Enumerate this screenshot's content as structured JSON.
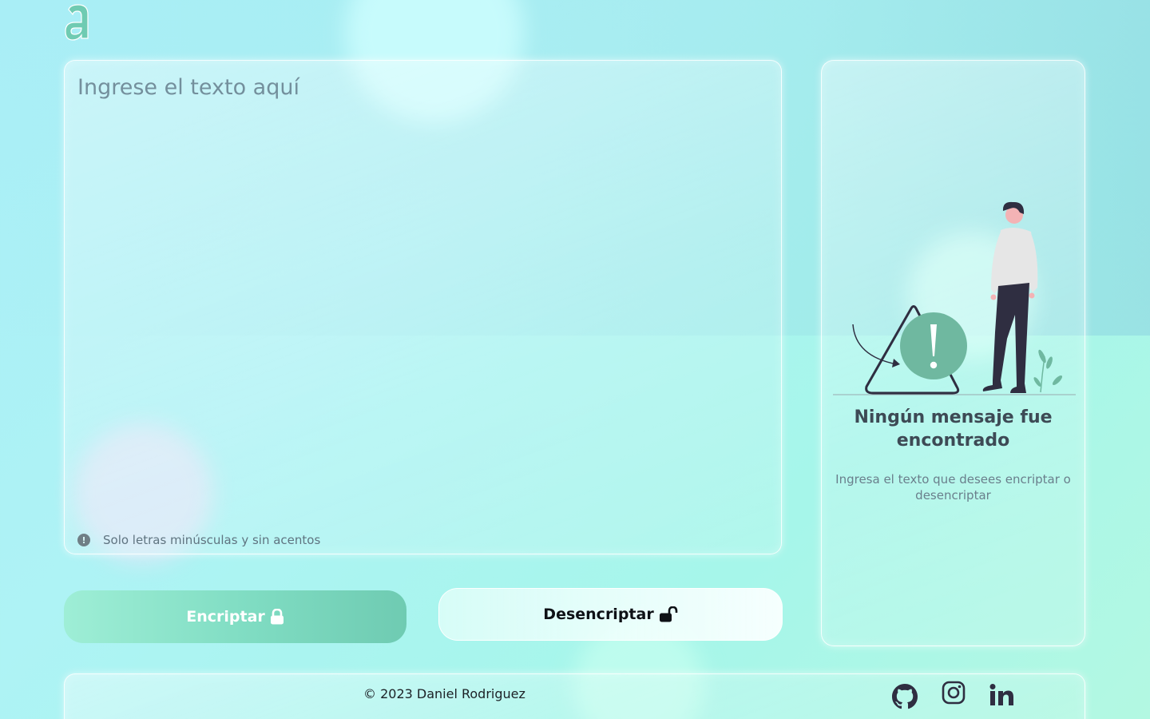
{
  "logo": {
    "glyph": "a",
    "color": "#6fcbb2"
  },
  "editor": {
    "placeholder": "Ingrese el texto aquí",
    "value": "",
    "hint_icon": "exclamation-circle-icon",
    "hint_text": "Solo letras minúsculas y sin acentos"
  },
  "actions": {
    "encrypt_label": "Encriptar",
    "encrypt_icon": "lock-closed-icon",
    "decrypt_label": "Desencriptar",
    "decrypt_icon": "lock-open-icon"
  },
  "output": {
    "title": "Ningún mensaje fue encontrado",
    "subtitle": "Ingresa el texto que desees encriptar o desencriptar",
    "illustration": "person-with-warning-sign"
  },
  "footer": {
    "copyright": "© 2023 Daniel Rodriguez",
    "social": [
      "github-icon",
      "instagram-icon",
      "linkedin-icon"
    ]
  },
  "colors": {
    "accent": "#6fcbb2",
    "accent_light": "#9eeed6",
    "text_dark": "#3d4a55"
  }
}
